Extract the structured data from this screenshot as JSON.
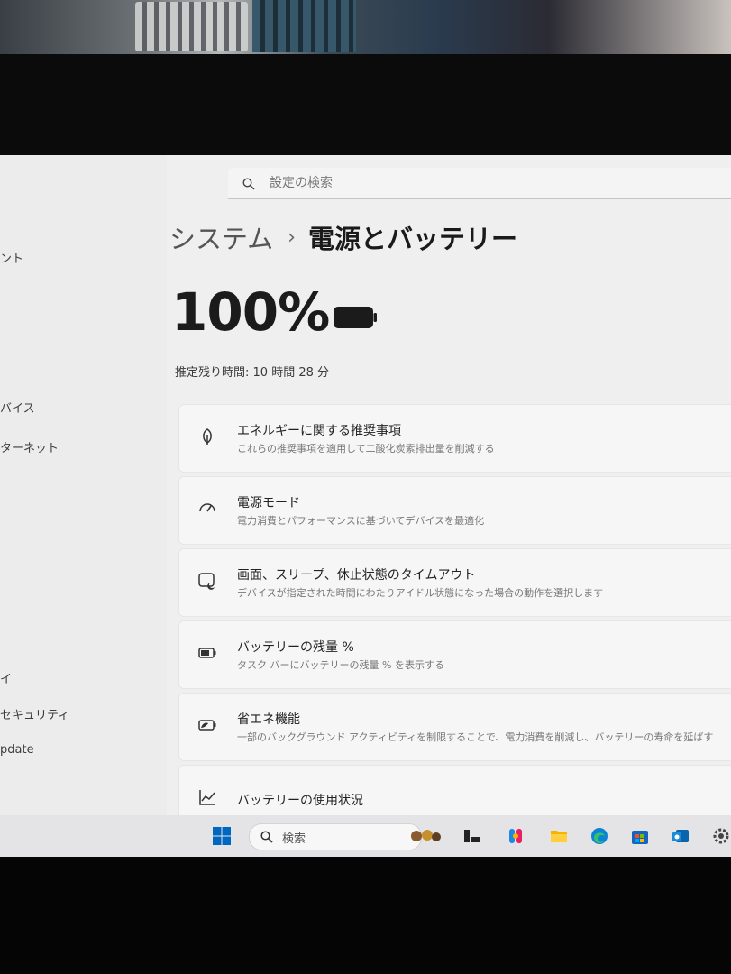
{
  "search": {
    "placeholder": "設定の検索"
  },
  "breadcrumb": {
    "parent": "システム",
    "separator": "›",
    "current": "電源とバッテリー"
  },
  "battery": {
    "percent": "100%",
    "remaining_label": "推定残り時間:",
    "remaining_value": "10 時間 28 分"
  },
  "sidebar": {
    "items": [
      {
        "label": "ント"
      },
      {
        "label": "バイス"
      },
      {
        "label": "ターネット"
      },
      {
        "label": "イ"
      },
      {
        "label": "セキュリティ"
      },
      {
        "label": "pdate"
      }
    ]
  },
  "cards": [
    {
      "title": "エネルギーに関する推奨事項",
      "desc": "これらの推奨事項を適用して二酸化炭素排出量を削減する",
      "icon": "leaf-icon"
    },
    {
      "title": "電源モード",
      "desc": "電力消費とパフォーマンスに基づいてデバイスを最適化",
      "icon": "power-mode-icon"
    },
    {
      "title": "画面、スリープ、休止状態のタイムアウト",
      "desc": "デバイスが指定された時間にわたりアイドル状態になった場合の動作を選択します",
      "icon": "screen-sleep-icon"
    },
    {
      "title": "バッテリーの残量 %",
      "desc": "タスク バーにバッテリーの残量 % を表示する",
      "icon": "battery-percent-icon"
    },
    {
      "title": "省エネ機能",
      "desc": "一部のバックグラウンド アクティビティを制限することで、電力消費を削減し、バッテリーの寿命を延ばす",
      "icon": "energy-saver-icon"
    },
    {
      "title": "バッテリーの使用状況",
      "icon": "usage-chart-icon"
    }
  ],
  "taskbar": {
    "search_label": "検索"
  },
  "colors": {
    "accent": "#0067c0",
    "text": "#1b1b1b"
  }
}
